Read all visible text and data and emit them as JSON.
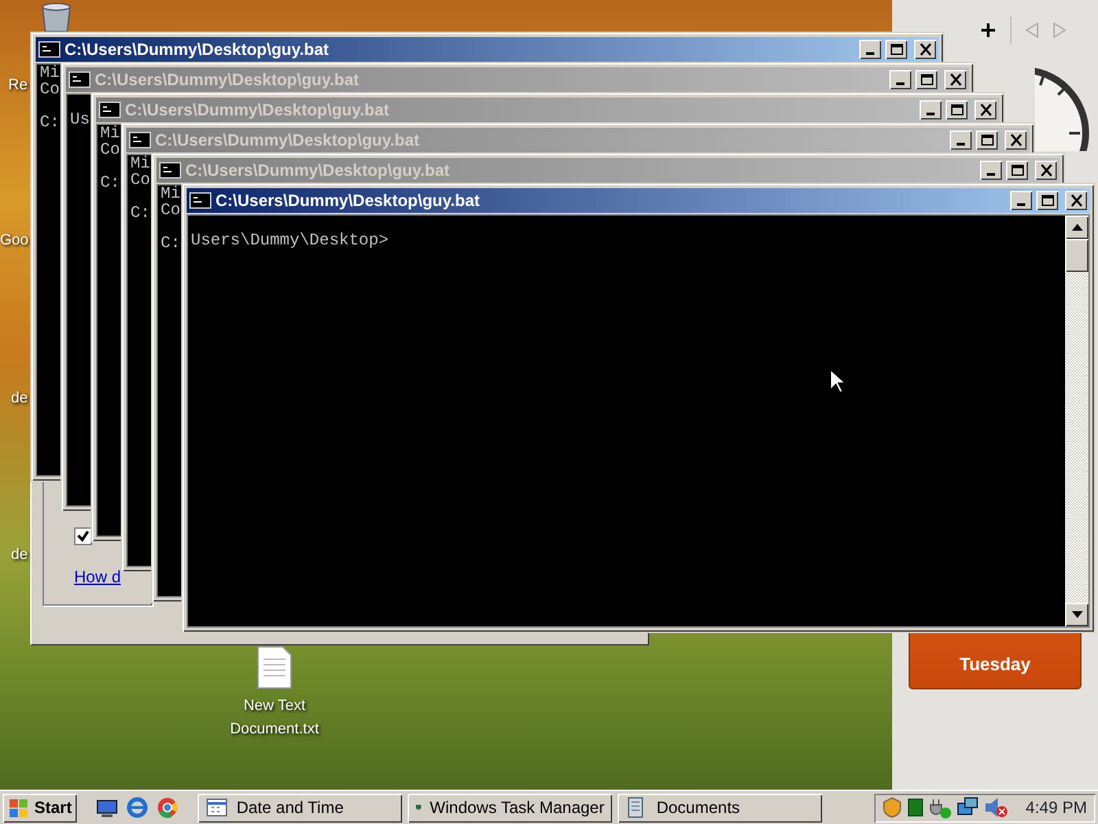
{
  "desktop": {
    "icon_labels": [
      "Re",
      "Goo",
      "de",
      "de"
    ],
    "file_icon": {
      "label": "New Text Document.txt"
    }
  },
  "background_dialog": {
    "checkbox": {
      "checked": true
    },
    "link": "How d"
  },
  "console_windows": [
    {
      "title": "C:\\Users\\Dummy\\Desktop\\guy.bat",
      "active": true,
      "lines": [
        {
          "kind": "text",
          "text": "Mi"
        },
        {
          "kind": "text",
          "text": "Co"
        },
        {
          "kind": "blank"
        },
        {
          "kind": "text",
          "text": "C:"
        }
      ]
    },
    {
      "title": "C:\\Users\\Dummy\\Desktop\\guy.bat",
      "active": false,
      "lines": [
        {
          "kind": "blank"
        },
        {
          "kind": "text",
          "text": "Us"
        }
      ]
    },
    {
      "title": "C:\\Users\\Dummy\\Desktop\\guy.bat",
      "active": false,
      "lines": [
        {
          "kind": "text",
          "text": "Mi"
        },
        {
          "kind": "text",
          "text": "Co"
        },
        {
          "kind": "blank"
        },
        {
          "kind": "text",
          "text": "C:"
        }
      ]
    },
    {
      "title": "C:\\Users\\Dummy\\Desktop\\guy.bat",
      "active": false,
      "lines": [
        {
          "kind": "text",
          "text": "Mi"
        },
        {
          "kind": "text",
          "text": "Co"
        },
        {
          "kind": "blank"
        },
        {
          "kind": "text",
          "text": "C:"
        }
      ]
    },
    {
      "title": "C:\\Users\\Dummy\\Desktop\\guy.bat",
      "active": false,
      "lines": [
        {
          "kind": "text",
          "text": "Mi"
        },
        {
          "kind": "text",
          "text": "Co"
        },
        {
          "kind": "blank"
        },
        {
          "kind": "text",
          "text": "C:"
        }
      ]
    },
    {
      "title": "C:\\Users\\Dummy\\Desktop\\guy.bat",
      "active": true,
      "lines": [
        {
          "kind": "blank"
        },
        {
          "kind": "text",
          "text": "Users\\Dummy\\Desktop>"
        }
      ]
    }
  ],
  "gadgets": {
    "calendar": {
      "day": "Tuesday"
    }
  },
  "taskbar": {
    "start": "Start",
    "tasks": [
      {
        "kind": "calendar",
        "label": "Date and Time"
      },
      {
        "kind": "monitor",
        "label": "Windows Task Manager"
      },
      {
        "kind": "folder",
        "label": "Documents"
      }
    ],
    "clock": "4:49 PM"
  }
}
